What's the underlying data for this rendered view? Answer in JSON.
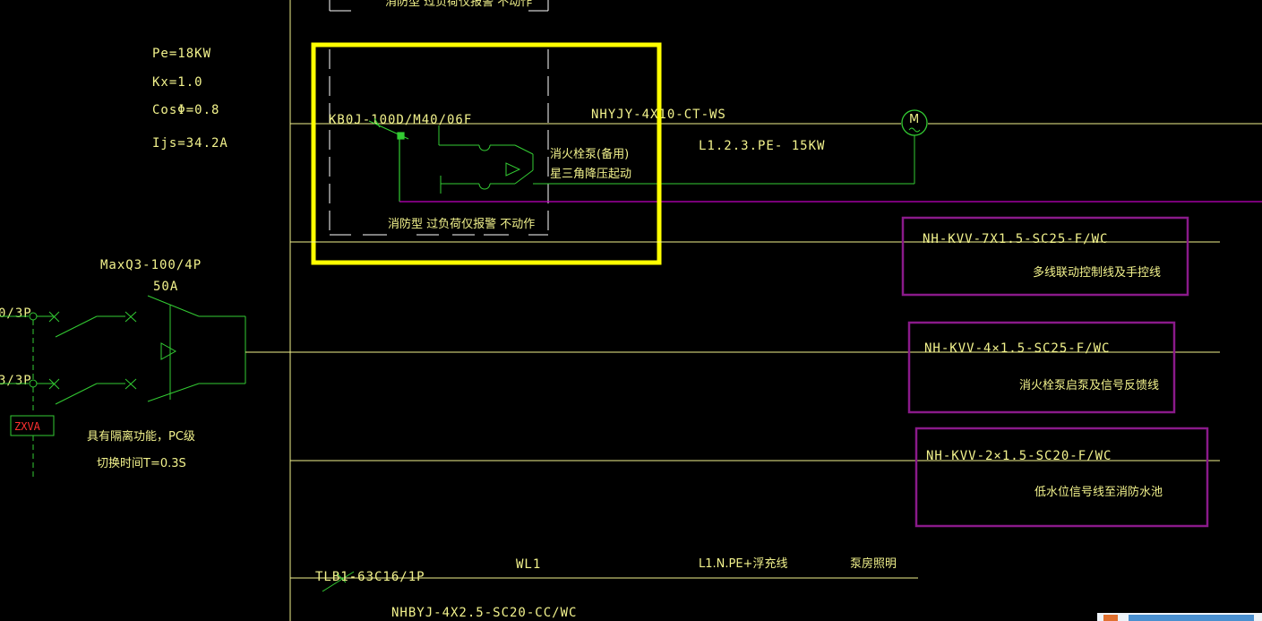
{
  "params": {
    "pe": "Pe=18KW",
    "kx": "Kx=1.0",
    "cos": "CosΦ=0.8",
    "ijs": "Ijs=34.2A"
  },
  "main_switch": {
    "model": "MaxQ3-100/4P",
    "current": "50A",
    "feature": "具有隔离功能，PC级",
    "switch_time": "切换时间T=0.3S",
    "zxva": "ZXVA",
    "left_label_1": "0/3P",
    "left_label_2": "3/3P"
  },
  "pump_circuit": {
    "breaker": "KB0J-100D/M40/06F",
    "cable": "NHYJY-4X10-CT-WS",
    "phase": "L1.2.3.PE-  15KW",
    "pump_name": "消火栓泵(备用)",
    "pump_start": "星三角降压起动",
    "overload_note": "消防型 过负荷仅报警 不动作",
    "top_note": "消防型 过负荷仅报警 不动作",
    "motor": "M"
  },
  "control_lines": [
    {
      "cable": "NH-KVV-7X1.5-SC25-F/WC",
      "desc": "多线联动控制线及手控线"
    },
    {
      "cable": "NH-KVV-4×1.5-SC25-F/WC",
      "desc": "消火栓泵启泵及信号反馈线"
    },
    {
      "cable": "NH-KVV-2×1.5-SC20-F/WC",
      "desc": "低水位信号线至消防水池"
    }
  ],
  "lighting": {
    "breaker": "TLB1-63C16/1P",
    "circuit": "WL1",
    "phase": "L1.N.PE+浮充线",
    "desc": "泵房照明",
    "cable": "NHBYJ-4X2.5-SC20-CC/WC"
  },
  "colors": {
    "background": "#000000",
    "wire": "#f2f28c",
    "green": "#33cc33",
    "magenta": "#c000c0",
    "highlight": "#ffff00",
    "purple_box": "#8a1a8a",
    "white_dash": "#ffffff"
  }
}
